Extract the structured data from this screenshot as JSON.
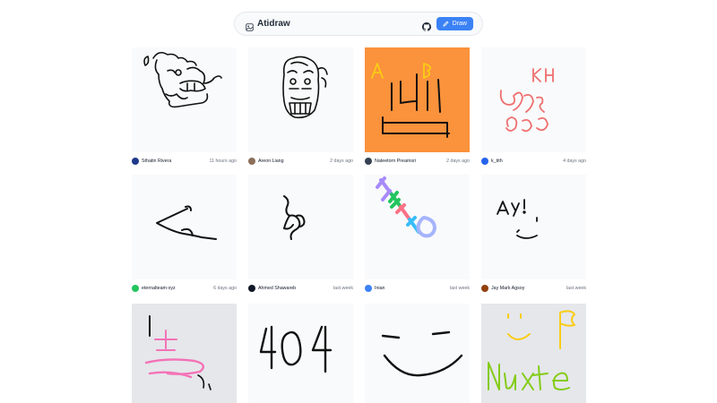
{
  "header": {
    "title": "Atidraw",
    "draw_label": "Draw",
    "logo_icon": "image-icon",
    "github_icon": "github-icon"
  },
  "colors": {
    "accent": "#3b82f6",
    "canvas_bg": "#f9fafb"
  },
  "drawings": [
    {
      "author": "Sthatin Rivera",
      "time": "11 hours ago",
      "bg": "#f9fafb",
      "avatar": "#1e3a8a"
    },
    {
      "author": "Areon Liang",
      "time": "2 days ago",
      "bg": "#f9fafb",
      "avatar": "#8b6f5a"
    },
    {
      "author": "Nateetorn Preamsri",
      "time": "2 days ago",
      "bg": "#fb923c",
      "avatar": "#374151"
    },
    {
      "author": "k_tith",
      "time": "4 days ago",
      "bg": "#f9fafb",
      "avatar": "#2563eb"
    },
    {
      "author": "eternalteam-xyz",
      "time": "6 days ago",
      "bg": "#f9fafb",
      "avatar": "#22c55e"
    },
    {
      "author": "Ahmed Shawareb",
      "time": "last week",
      "bg": "#f9fafb",
      "avatar": "#111827"
    },
    {
      "author": "Inian",
      "time": "last week",
      "bg": "#f9fafb",
      "avatar": "#3b82f6"
    },
    {
      "author": "Jay Mark Agsoy",
      "time": "last week",
      "bg": "#f9fafb",
      "avatar": "#92400e"
    },
    {
      "author": "",
      "time": "",
      "bg": "#e5e7eb",
      "avatar": ""
    },
    {
      "author": "",
      "time": "",
      "bg": "#f9fafb",
      "avatar": ""
    },
    {
      "author": "",
      "time": "",
      "bg": "#f9fafb",
      "avatar": ""
    },
    {
      "author": "",
      "time": "",
      "bg": "#e5e7eb",
      "avatar": ""
    }
  ]
}
